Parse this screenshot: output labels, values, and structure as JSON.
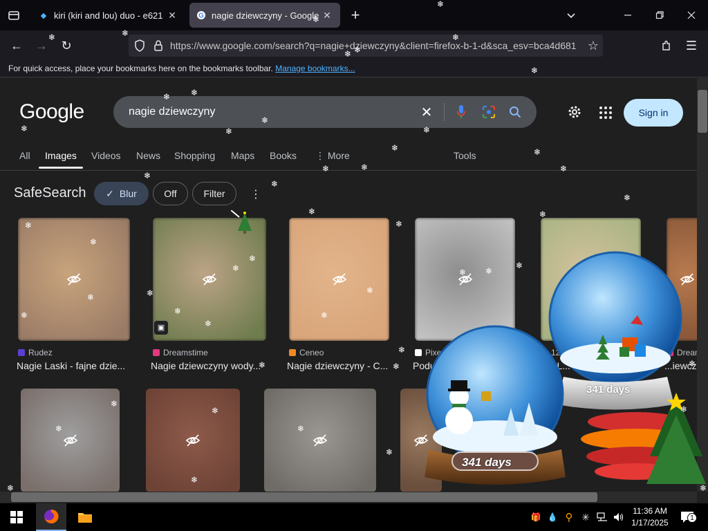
{
  "browser": {
    "tabs": [
      {
        "title": "kiri (kiri and lou) duo - e621",
        "active": false
      },
      {
        "title": "nagie dziewczyny - Google Search",
        "active": true
      }
    ],
    "url": "https://www.google.com/search?q=nagie+dziewczyny&client=firefox-b-1-d&sca_esv=bca4d681",
    "bookmarks_msg": "For quick access, place your bookmarks here on the bookmarks toolbar.",
    "bookmarks_link": "Manage bookmarks..."
  },
  "google": {
    "logo": "Google",
    "query": "nagie dziewczyny",
    "signin": "Sign in",
    "tabs": [
      "All",
      "Images",
      "Videos",
      "News",
      "Shopping",
      "Maps",
      "Books",
      "More",
      "Tools"
    ],
    "safesearch": {
      "label": "SafeSearch",
      "blur": "Blur",
      "off": "Off",
      "filter": "Filter"
    }
  },
  "results": [
    {
      "source": "Rudez",
      "caption": "Nagie Laski - fajne dzie...",
      "c1": "#c8a47c",
      "c2": "#9a7b66",
      "fav": "#5d3fd3"
    },
    {
      "source": "Dreamstime",
      "caption": "Nagie dziewczyny wody...",
      "c1": "#bca487",
      "c2": "#6f7c4e",
      "fav": "#e13b7b"
    },
    {
      "source": "Ceneo",
      "caption": "Nagie dziewczyny - C...",
      "c1": "#e2b48a",
      "c2": "#d9a57a",
      "fav": "#f08a24"
    },
    {
      "source": "Pixers",
      "caption": "Podus...",
      "c1": "#8d8d8d",
      "c2": "#c2c2c2",
      "fav": "#ffffff"
    },
    {
      "source": "123RF",
      "caption": "...ie L...",
      "c1": "#d4c29c",
      "c2": "#a7b383",
      "fav": "#6b8e23"
    },
    {
      "source": "Dream...",
      "caption": "...iewcz",
      "c1": "#b87a4f",
      "c2": "#8c5a3a",
      "fav": "#e13b7b"
    }
  ],
  "row2": [
    {
      "c1": "#9e9e9e",
      "c2": "#7a6f6b"
    },
    {
      "c1": "#8e5a4a",
      "c2": "#6d4336"
    },
    {
      "c1": "#9a9692",
      "c2": "#6f6b66"
    },
    {
      "c1": "#9a7a60",
      "c2": "#6a4f3d"
    }
  ],
  "widget": {
    "days_1": "341 days",
    "days_2": "341 days"
  },
  "taskbar": {
    "time": "11:36 AM",
    "date": "1/17/2025",
    "notifications": "1"
  }
}
